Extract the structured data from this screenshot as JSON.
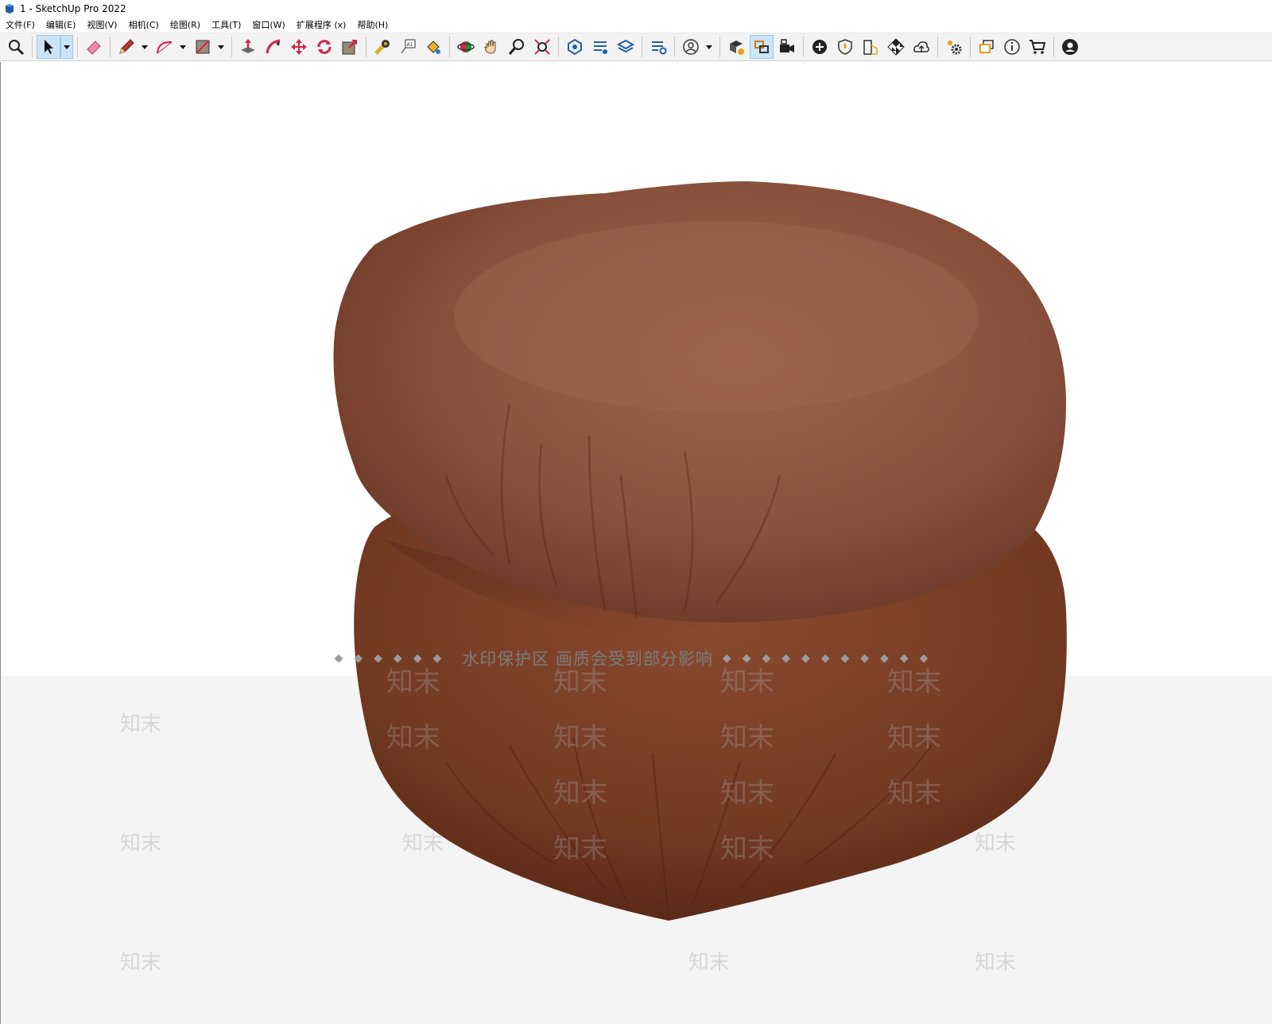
{
  "window": {
    "title": "1 - SketchUp Pro 2022"
  },
  "menu": {
    "items": [
      {
        "label": "文件(F)"
      },
      {
        "label": "编辑(E)"
      },
      {
        "label": "视图(V)"
      },
      {
        "label": "相机(C)"
      },
      {
        "label": "绘图(R)"
      },
      {
        "label": "工具(T)"
      },
      {
        "label": "窗口(W)"
      },
      {
        "label": "扩展程序 (x)"
      },
      {
        "label": "帮助(H)"
      }
    ]
  },
  "toolbar": {
    "active_tool": "select",
    "tools": [
      "zoom",
      "select",
      "eraser",
      "pencil-line",
      "arc",
      "shape",
      "push-pull",
      "follow-me",
      "move",
      "rotate",
      "scale",
      "tape-measure",
      "text",
      "paint-bucket",
      "orbit",
      "pan",
      "zoom-window",
      "zoom-extents",
      "warehouse",
      "extension-warehouse",
      "layout",
      "extension-manager",
      "profile",
      "model-info",
      "outliner",
      "scenes",
      "add",
      "shield",
      "materials",
      "styles",
      "cloud",
      "settings",
      "window",
      "info",
      "cart",
      "account"
    ]
  },
  "colors": {
    "pouf_top": "#8e5640",
    "pouf_bottom": "#7a3e26",
    "accent": "#cce4f7"
  },
  "viewport": {
    "watermark_notice": "水印保护区  画质会受到部分影响",
    "watermark_brand": "知末"
  }
}
